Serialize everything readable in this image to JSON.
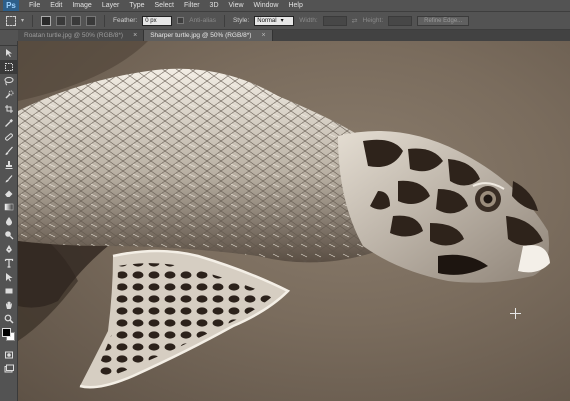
{
  "app": {
    "logo": "Ps"
  },
  "menu": [
    "File",
    "Edit",
    "Image",
    "Layer",
    "Type",
    "Select",
    "Filter",
    "3D",
    "View",
    "Window",
    "Help"
  ],
  "options": {
    "feather_label": "Feather:",
    "feather_value": "0 px",
    "antialias_label": "Anti-alias",
    "style_label": "Style:",
    "style_value": "Normal",
    "width_label": "Width:",
    "height_label": "Height:",
    "refine_edge": "Refine Edge..."
  },
  "tabs": [
    {
      "label": "Roatan turtle.jpg @ 50% (RGB/8*)",
      "active": false
    },
    {
      "label": "Sharper turtle.jpg @ 50% (RGB/8*)",
      "active": true
    }
  ],
  "tab_close": "×",
  "colors": {
    "foreground": "#000000",
    "background": "#ffffff",
    "canvas_bg": "#7a6c5d",
    "turtle_light": "#e8e2d8",
    "turtle_dark": "#2a1f18"
  },
  "cursor_icon": "crosshair-icon"
}
